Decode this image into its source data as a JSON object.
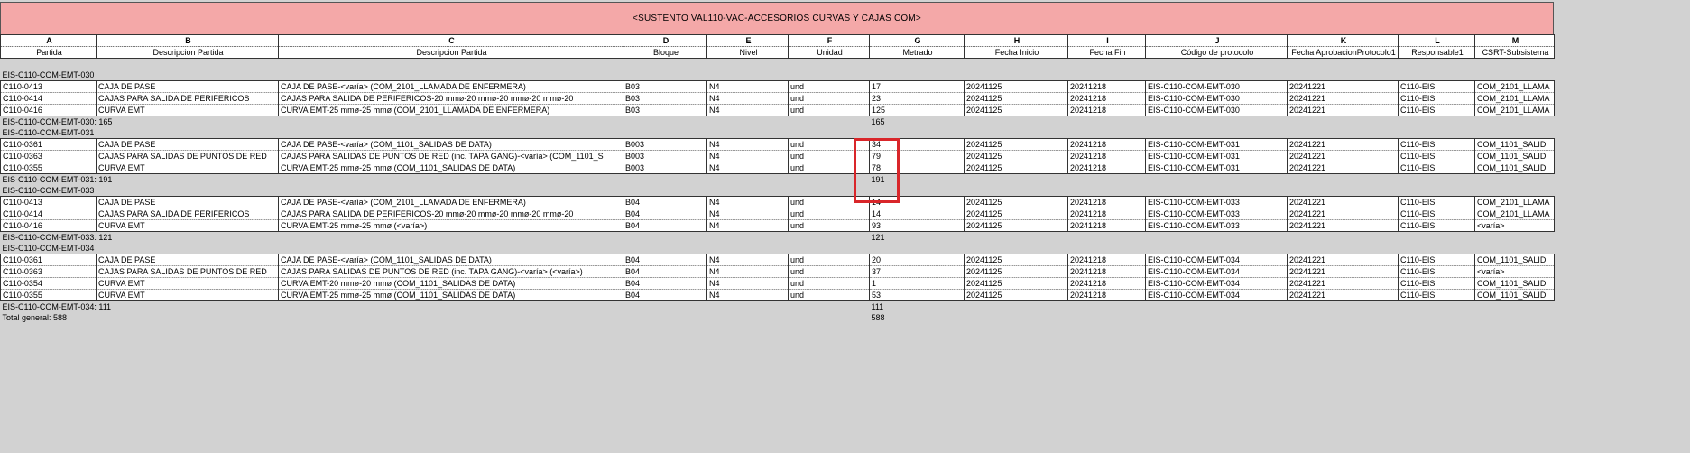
{
  "title": "<SUSTENTO VAL110-VAC-ACCESORIOS CURVAS Y CAJAS COM>",
  "column_letters": [
    "A",
    "B",
    "C",
    "D",
    "E",
    "F",
    "G",
    "H",
    "I",
    "J",
    "K",
    "L",
    "M"
  ],
  "column_headers": [
    "Partida",
    "Descripcion Partida",
    "Descripcion Partida",
    "Bloque",
    "Nivel",
    "Unidad",
    "Metrado",
    "Fecha Inicio",
    "Fecha Fin",
    "Código de protocolo",
    "Fecha AprobacionProtocolo1",
    "Responsable1",
    "CSRT-Subsistema"
  ],
  "groups": [
    {
      "label": "EIS-C110-COM-EMT-030",
      "rows": [
        [
          "C110-0413",
          "CAJA DE PASE",
          "CAJA DE PASE-<varía> (COM_2101_LLAMADA DE ENFERMERA)",
          "B03",
          "N4",
          "und",
          "17",
          "20241125",
          "20241218",
          "EIS-C110-COM-EMT-030",
          "20241221",
          "C110-EIS",
          "COM_2101_LLAMA"
        ],
        [
          "C110-0414",
          "CAJAS PARA SALIDA DE PERIFERICOS",
          "CAJAS PARA SALIDA DE PERIFERICOS-20 mmø-20 mmø-20 mmø-20 mmø-20",
          "B03",
          "N4",
          "und",
          "23",
          "20241125",
          "20241218",
          "EIS-C110-COM-EMT-030",
          "20241221",
          "C110-EIS",
          "COM_2101_LLAMA"
        ],
        [
          "C110-0416",
          "CURVA EMT",
          "CURVA EMT-25 mmø-25 mmø (COM_2101_LLAMADA DE ENFERMERA)",
          "B03",
          "N4",
          "und",
          "125",
          "20241125",
          "20241218",
          "EIS-C110-COM-EMT-030",
          "20241221",
          "C110-EIS",
          "COM_2101_LLAMA"
        ]
      ],
      "subtotal_label": "EIS-C110-COM-EMT-030: 165",
      "subtotal_value": "165"
    },
    {
      "label": "EIS-C110-COM-EMT-031",
      "rows": [
        [
          "C110-0361",
          "CAJA DE PASE",
          "CAJA DE PASE-<varía> (COM_1101_SALIDAS DE DATA)",
          "B003",
          "N4",
          "und",
          "34",
          "20241125",
          "20241218",
          "EIS-C110-COM-EMT-031",
          "20241221",
          "C110-EIS",
          "COM_1101_SALID"
        ],
        [
          "C110-0363",
          "CAJAS PARA SALIDAS DE PUNTOS DE RED",
          "CAJAS PARA SALIDAS DE PUNTOS DE RED (inc. TAPA GANG)-<varía> (COM_1101_S",
          "B003",
          "N4",
          "und",
          "79",
          "20241125",
          "20241218",
          "EIS-C110-COM-EMT-031",
          "20241221",
          "C110-EIS",
          "COM_1101_SALID"
        ],
        [
          "C110-0355",
          "CURVA EMT",
          "CURVA EMT-25 mmø-25 mmø (COM_1101_SALIDAS DE DATA)",
          "B003",
          "N4",
          "und",
          "78",
          "20241125",
          "20241218",
          "EIS-C110-COM-EMT-031",
          "20241221",
          "C110-EIS",
          "COM_1101_SALID"
        ]
      ],
      "subtotal_label": "EIS-C110-COM-EMT-031: 191",
      "subtotal_value": "191"
    },
    {
      "label": "EIS-C110-COM-EMT-033",
      "rows": [
        [
          "C110-0413",
          "CAJA DE PASE",
          "CAJA DE PASE-<varía> (COM_2101_LLAMADA DE ENFERMERA)",
          "B04",
          "N4",
          "und",
          "14",
          "20241125",
          "20241218",
          "EIS-C110-COM-EMT-033",
          "20241221",
          "C110-EIS",
          "COM_2101_LLAMA"
        ],
        [
          "C110-0414",
          "CAJAS PARA SALIDA DE PERIFERICOS",
          "CAJAS PARA SALIDA DE PERIFERICOS-20 mmø-20 mmø-20 mmø-20 mmø-20",
          "B04",
          "N4",
          "und",
          "14",
          "20241125",
          "20241218",
          "EIS-C110-COM-EMT-033",
          "20241221",
          "C110-EIS",
          "COM_2101_LLAMA"
        ],
        [
          "C110-0416",
          "CURVA EMT",
          "CURVA EMT-25 mmø-25 mmø (<varía>)",
          "B04",
          "N4",
          "und",
          "93",
          "20241125",
          "20241218",
          "EIS-C110-COM-EMT-033",
          "20241221",
          "C110-EIS",
          "<varía>"
        ]
      ],
      "subtotal_label": "EIS-C110-COM-EMT-033: 121",
      "subtotal_value": "121"
    },
    {
      "label": "EIS-C110-COM-EMT-034",
      "rows": [
        [
          "C110-0361",
          "CAJA DE PASE",
          "CAJA DE PASE-<varía> (COM_1101_SALIDAS DE DATA)",
          "B04",
          "N4",
          "und",
          "20",
          "20241125",
          "20241218",
          "EIS-C110-COM-EMT-034",
          "20241221",
          "C110-EIS",
          "COM_1101_SALID"
        ],
        [
          "C110-0363",
          "CAJAS PARA SALIDAS DE PUNTOS DE RED",
          "CAJAS PARA SALIDAS DE PUNTOS DE RED (inc. TAPA GANG)-<varía> (<varía>)",
          "B04",
          "N4",
          "und",
          "37",
          "20241125",
          "20241218",
          "EIS-C110-COM-EMT-034",
          "20241221",
          "C110-EIS",
          "<varía>"
        ],
        [
          "C110-0354",
          "CURVA EMT",
          "CURVA EMT-20 mmø-20 mmø (COM_1101_SALIDAS DE DATA)",
          "B04",
          "N4",
          "und",
          "1",
          "20241125",
          "20241218",
          "EIS-C110-COM-EMT-034",
          "20241221",
          "C110-EIS",
          "COM_1101_SALID"
        ],
        [
          "C110-0355",
          "CURVA EMT",
          "CURVA EMT-25 mmø-25 mmø (COM_1101_SALIDAS DE DATA)",
          "B04",
          "N4",
          "und",
          "53",
          "20241125",
          "20241218",
          "EIS-C110-COM-EMT-034",
          "20241221",
          "C110-EIS",
          "COM_1101_SALID"
        ]
      ],
      "subtotal_label": "EIS-C110-COM-EMT-034: 111",
      "subtotal_value": "111"
    }
  ],
  "total_label": "Total general: 588",
  "total_value": "588",
  "highlight_color": "#d9262a",
  "title_bg_color": "#f4a8a8"
}
